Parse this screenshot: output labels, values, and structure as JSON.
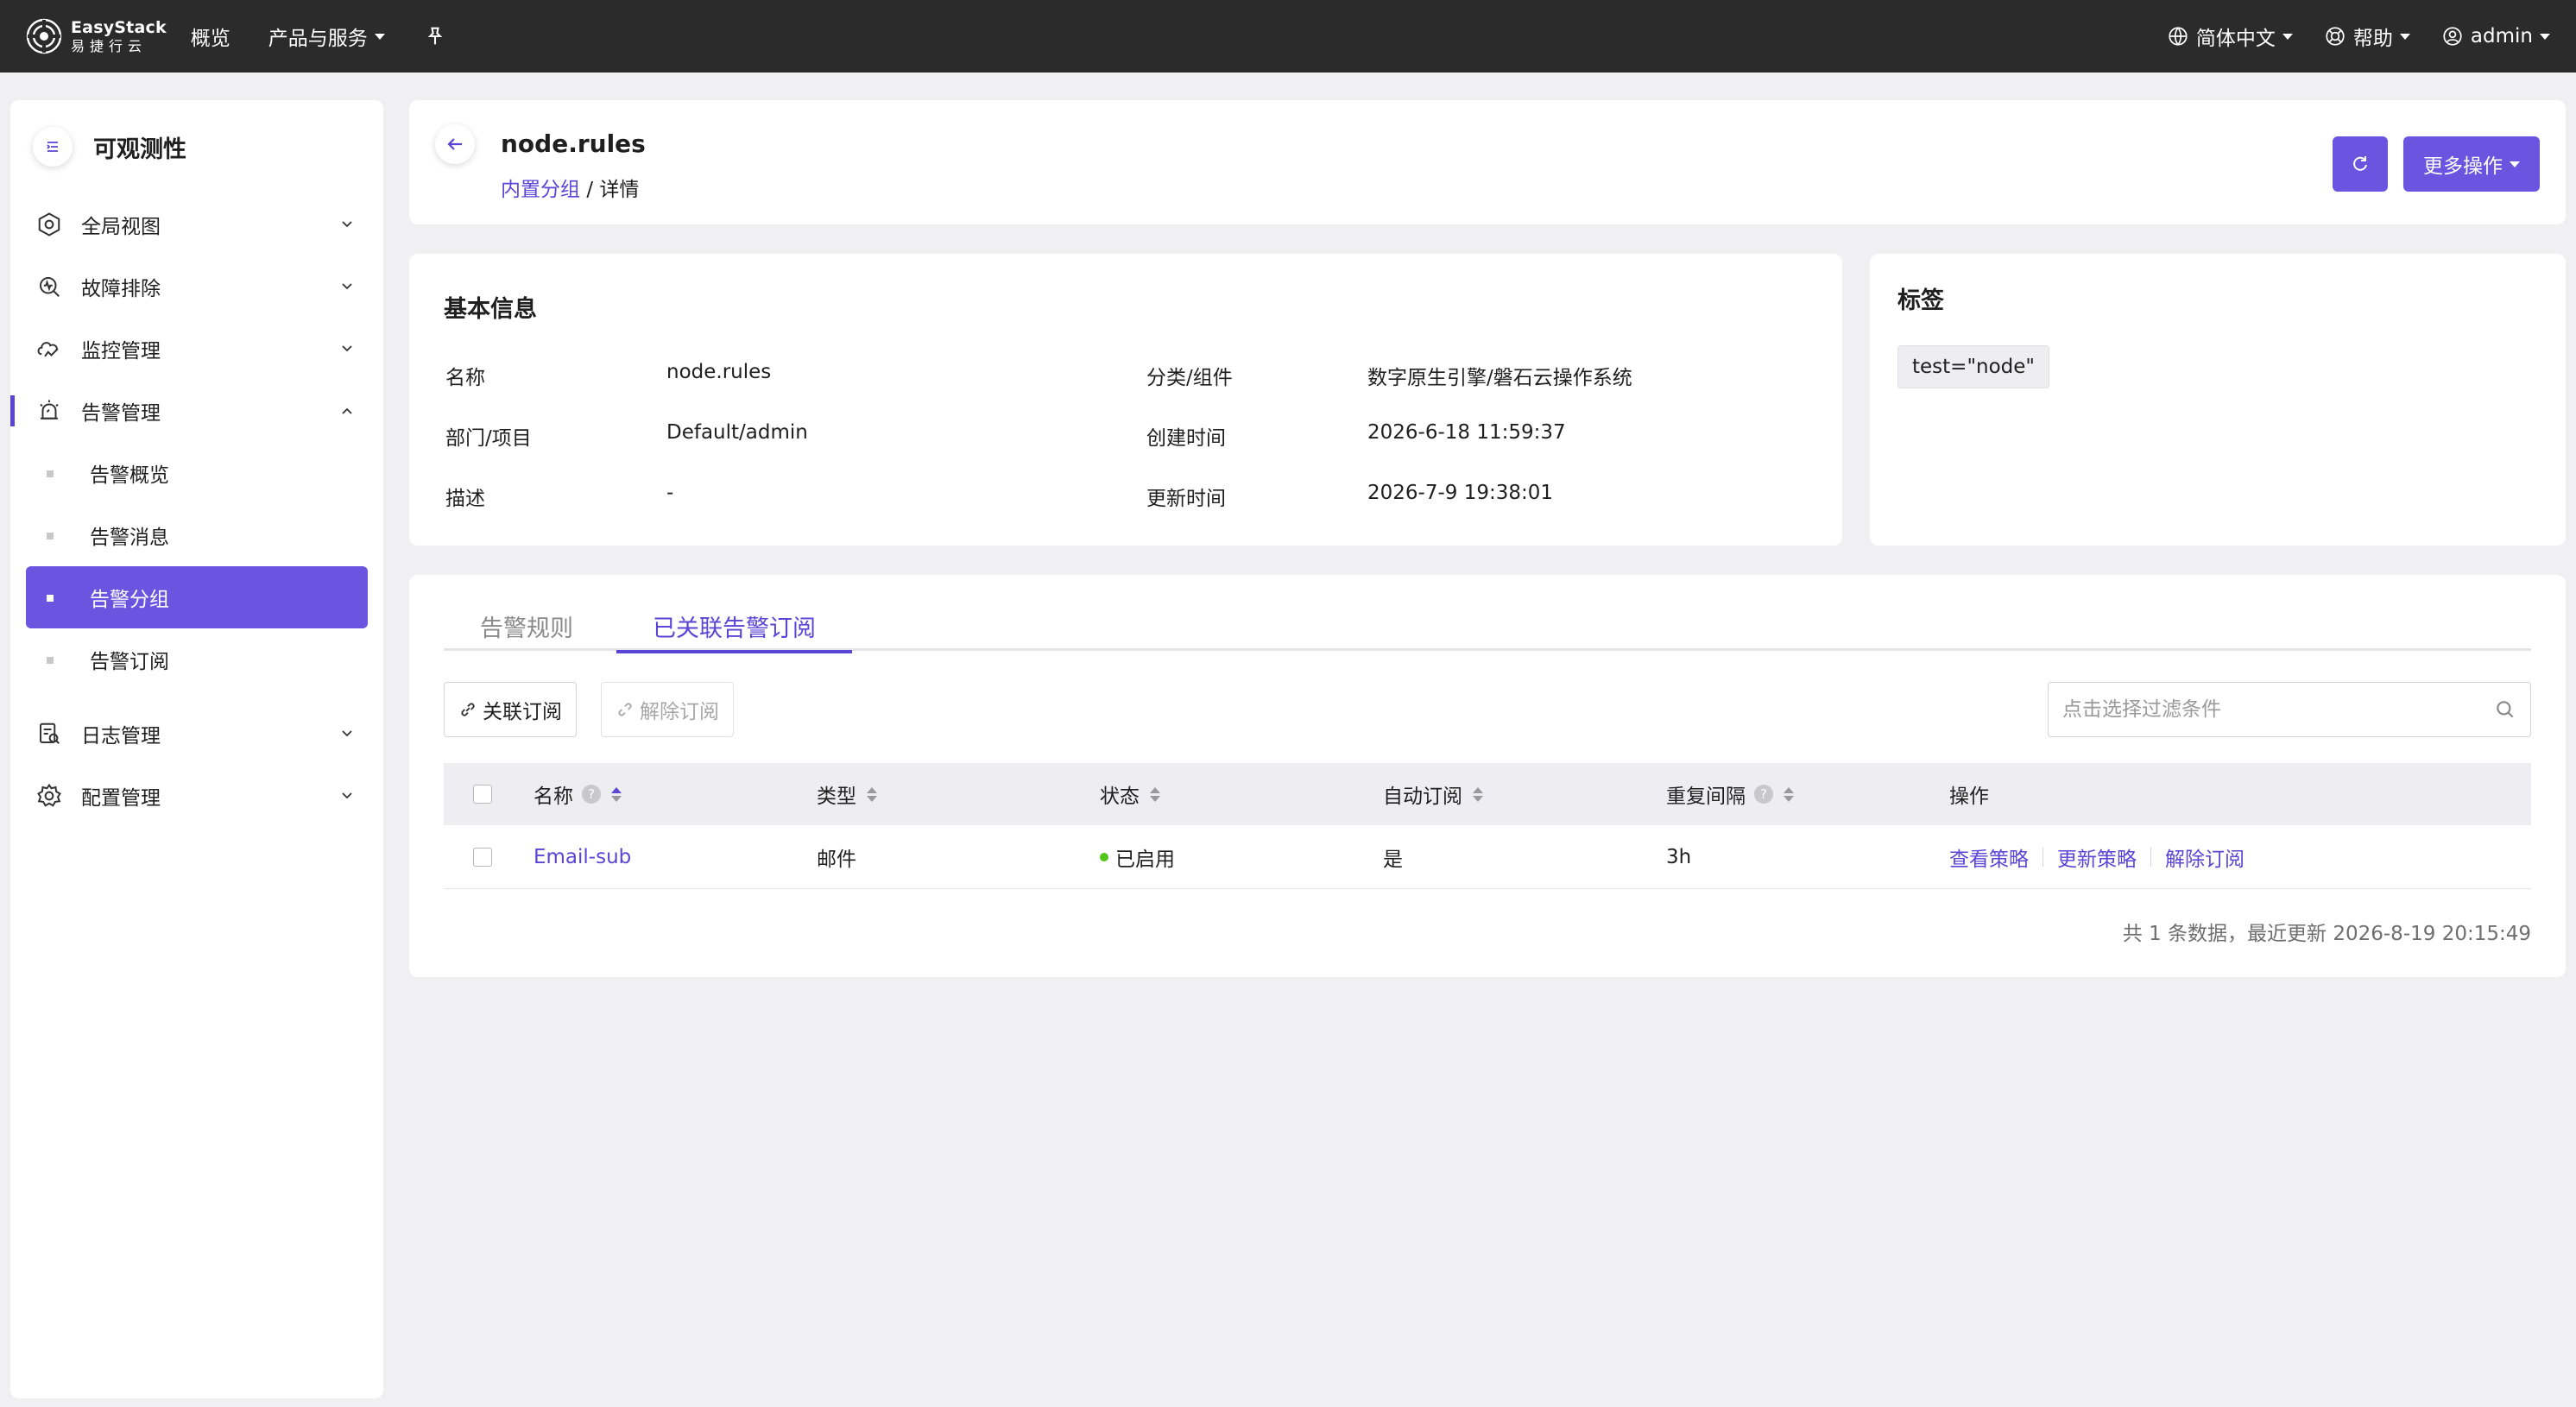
{
  "topbar": {
    "logo_en": "EasyStack",
    "logo_cn": "易捷行云",
    "nav": [
      "概览",
      "产品与服务"
    ],
    "language": "简体中文",
    "help": "帮助",
    "user": "admin"
  },
  "sidebar": {
    "title": "可观测性",
    "items": [
      {
        "label": "全局视图",
        "icon": "dashboard-icon"
      },
      {
        "label": "故障排除",
        "icon": "troubleshoot-icon"
      },
      {
        "label": "监控管理",
        "icon": "monitor-icon"
      },
      {
        "label": "告警管理",
        "icon": "alarm-icon"
      },
      {
        "label": "日志管理",
        "icon": "log-icon"
      },
      {
        "label": "配置管理",
        "icon": "gear-icon"
      }
    ],
    "sub_items": [
      "告警概览",
      "告警消息",
      "告警分组",
      "告警订阅"
    ],
    "active_sub": "告警分组",
    "accent": "#6a54e0"
  },
  "header": {
    "title": "node.rules",
    "breadcrumb_link": "内置分组",
    "breadcrumb_sep": "/",
    "breadcrumb_current": "详情",
    "more_actions": "更多操作"
  },
  "basic_info": {
    "title": "基本信息",
    "fields": [
      {
        "label": "名称",
        "value": "node.rules"
      },
      {
        "label": "部门/项目",
        "value": "Default/admin"
      },
      {
        "label": "描述",
        "value": "-"
      },
      {
        "label": "分类/组件",
        "value": "数字原生引擎/磐石云操作系统"
      },
      {
        "label": "创建时间",
        "value": "2026-6-18 11:59:37"
      },
      {
        "label": "更新时间",
        "value": "2026-7-9 19:38:01"
      }
    ]
  },
  "tags": {
    "title": "标签",
    "items": [
      "test=\"node\""
    ]
  },
  "tabs": [
    "告警规则",
    "已关联告警订阅"
  ],
  "active_tab": "已关联告警订阅",
  "toolbar": {
    "associate": "关联订阅",
    "unsubscribe": "解除订阅",
    "search_placeholder": "点击选择过滤条件"
  },
  "table": {
    "columns": [
      "名称",
      "类型",
      "状态",
      "自动订阅",
      "重复间隔",
      "操作"
    ],
    "rows": [
      {
        "name": "Email-sub",
        "type": "邮件",
        "status": "已启用",
        "auto": "是",
        "interval": "3h",
        "ops": [
          "查看策略",
          "更新策略",
          "解除订阅"
        ]
      }
    ],
    "footer": "共 1 条数据，最近更新  2026-8-19 20:15:49"
  },
  "colors": {
    "accent": "#5b45d6",
    "button": "#6a54e0",
    "status_ok": "#52c41a"
  }
}
